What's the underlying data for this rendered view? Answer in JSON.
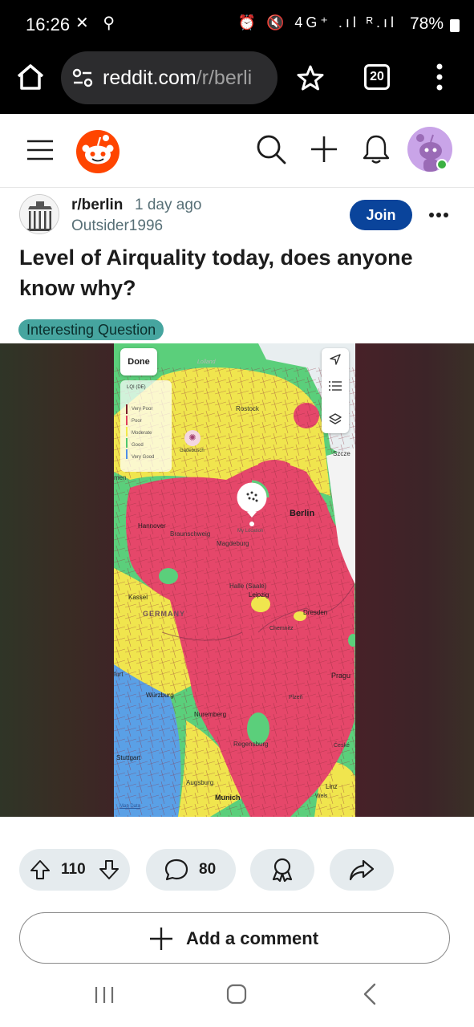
{
  "status_bar": {
    "time": "16:26",
    "left_icons": "✕ ⚲",
    "right_icons": "⏰ 🔇 4G⁺ .ıl ᴿ.ıl",
    "battery": "78%"
  },
  "browser": {
    "url_domain": "reddit.com",
    "url_path": "/r/berli",
    "tab_count": "20"
  },
  "post": {
    "subreddit": "r/berlin",
    "time_ago": "1 day ago",
    "author": "Outsider1996",
    "join_label": "Join",
    "title": "Level of Airquality today, does anyone know why?",
    "flair": "Interesting Question"
  },
  "map": {
    "done_label": "Done",
    "legend_title": "LQI (DE)",
    "legend": [
      {
        "label": "Very Poor",
        "color": "#7a1f2b"
      },
      {
        "label": "Poor",
        "color": "#e0405e"
      },
      {
        "label": "Moderate",
        "color": "#f2e84a"
      },
      {
        "label": "Good",
        "color": "#4fc76e"
      },
      {
        "label": "Very Good",
        "color": "#4f8fe8"
      }
    ],
    "cities": {
      "rostock": "Rostock",
      "gadebusch": "Gadebusch",
      "szczecin": "Szcze",
      "bremen": "men",
      "berlin": "Berlin",
      "my_location": "My Location",
      "hannover": "Hannover",
      "braunschweig": "Braunschweig",
      "magdeburg": "Magdeburg",
      "halle": "Halle (Saale)",
      "leipzig": "Leipzig",
      "kassel": "Kassel",
      "germany": "GERMANY",
      "dresden": "Dresden",
      "chemnitz": "Chemnitz",
      "frankfurt": "furt",
      "prague": "Pragu",
      "wurzburg": "Würzburg",
      "plzen": "Plzeň",
      "nuremberg": "Nuremberg",
      "regensburg": "Regensburg",
      "ceske": "České",
      "stuttgart": "Stuttgart",
      "augsburg": "Augsburg",
      "linz": "Linz",
      "munich": "Munich",
      "wels": "Wels",
      "lolland": "Lolland",
      "attribution": "Map Data"
    }
  },
  "actions": {
    "votes": "110",
    "comments": "80",
    "add_comment": "Add a comment"
  },
  "colors": {
    "join": "#0a449b",
    "flair": "#46a59f",
    "pill": "#e5ebee",
    "reddit_orange": "#ff4500"
  }
}
